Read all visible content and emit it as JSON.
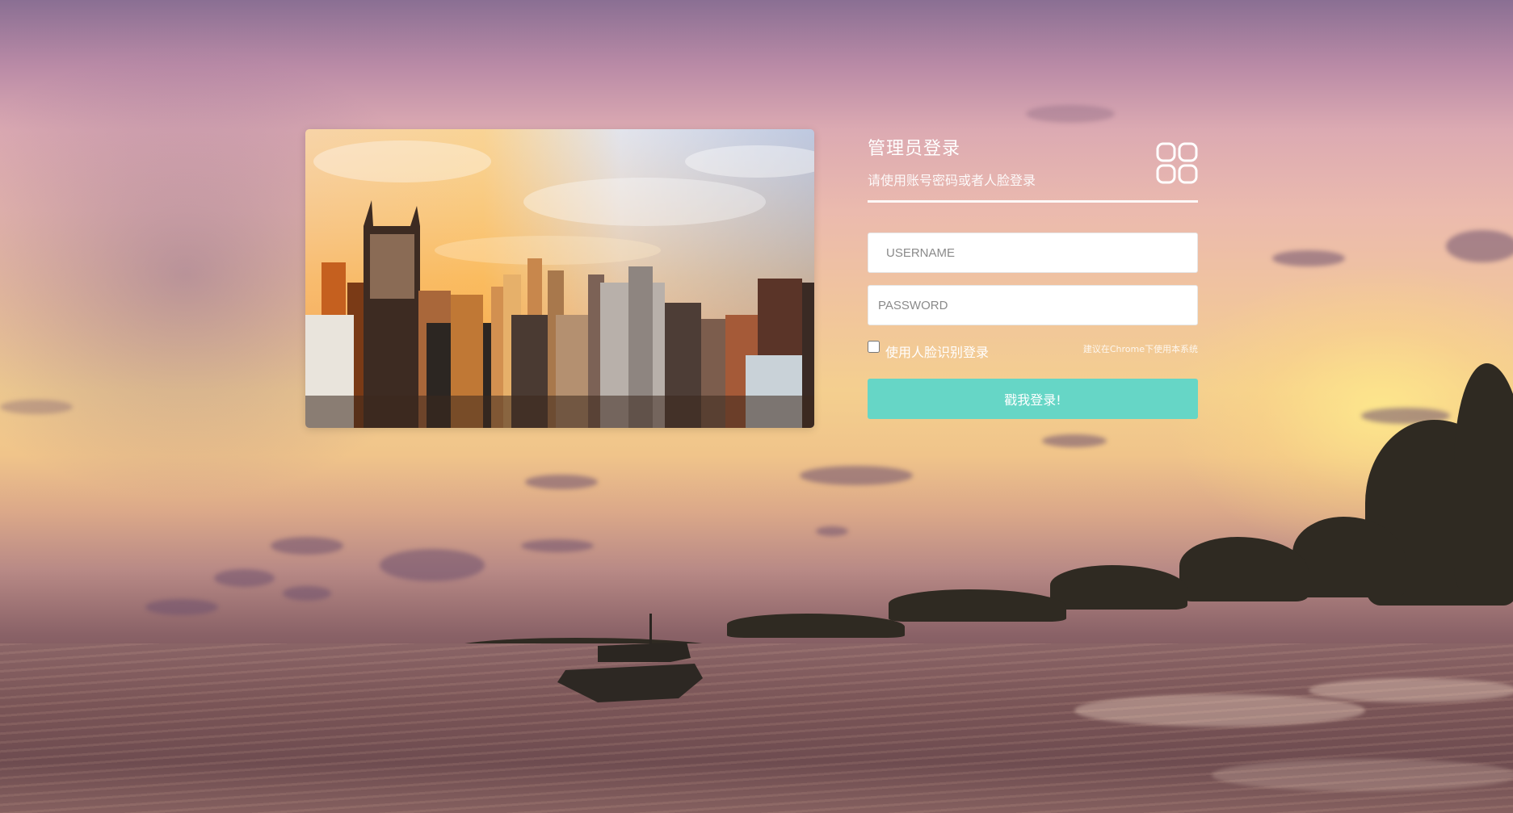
{
  "login": {
    "title": "管理员登录",
    "subtitle": "请使用账号密码或者人脸登录",
    "username_placeholder": "USERNAME",
    "password_placeholder": "PASSWORD",
    "face_login_label": "使用人脸识别登录",
    "face_login_checked": false,
    "browser_hint": "建议在Chrome下使用本系统",
    "submit_label": "戳我登录!"
  },
  "colors": {
    "accent": "#66d6c6",
    "text_on_background": "#ffffff"
  },
  "icons": {
    "header_icon": "grid-four-icon"
  }
}
